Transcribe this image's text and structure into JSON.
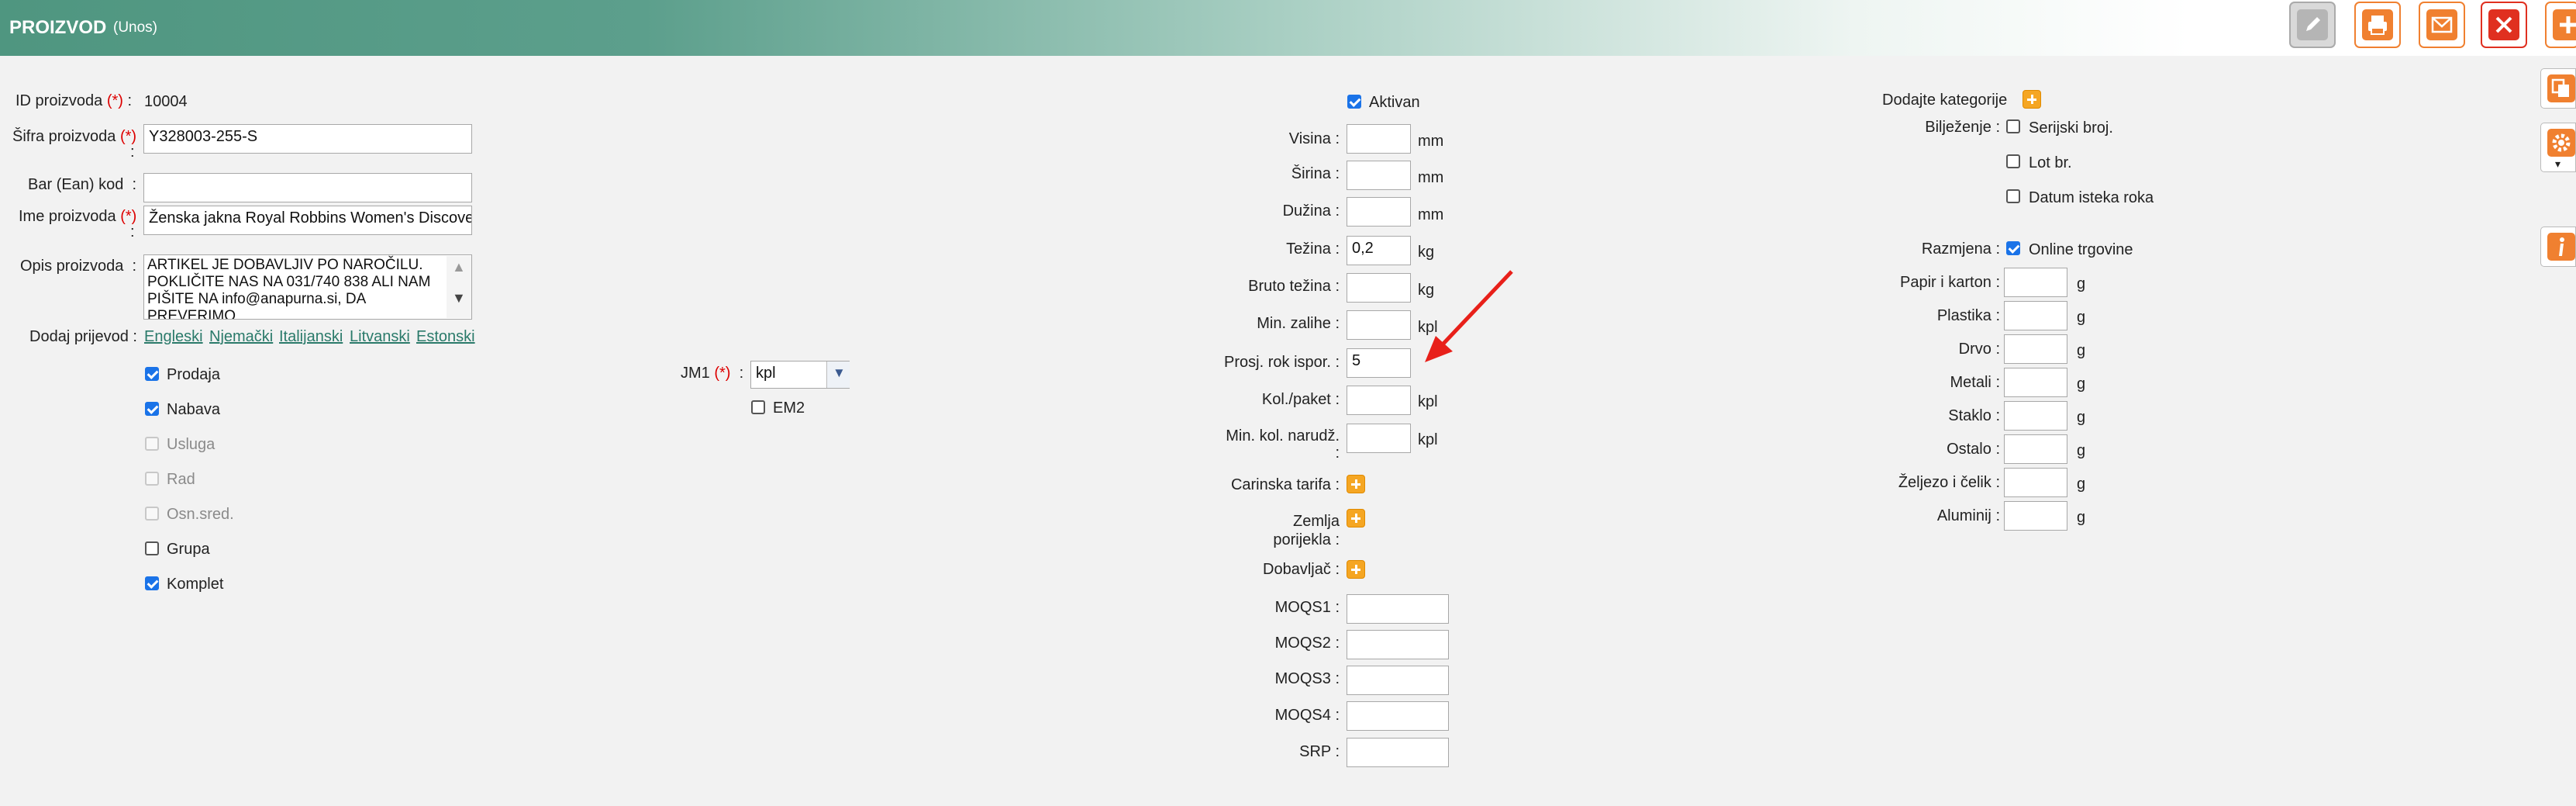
{
  "header": {
    "title": "PROIZVOD",
    "subtitle": "(Unos)",
    "buttons": [
      {
        "name": "edit-icon",
        "color": "#b0b0b0"
      },
      {
        "name": "print-icon",
        "color": "#f08030"
      },
      {
        "name": "email-icon",
        "color": "#f08030"
      },
      {
        "name": "close-icon",
        "color": "#e03020"
      },
      {
        "name": "add-icon",
        "color": "#f08030"
      }
    ]
  },
  "left": {
    "id_label": "ID proizvoda",
    "id_value": "10004",
    "sifra_label": "Šifra proizvoda",
    "sifra_value": "Y328003-255-S",
    "ean_label": "Bar (Ean) kod",
    "ean_value": "",
    "ime_label": "Ime proizvoda",
    "ime_value": "Ženska jakna Royal Robbins Women's Discovery",
    "opis_label": "Opis proizvoda",
    "opis_value": "ARTIKEL JE DOBAVLJIV PO NAROČILU. POKLIČITE NAS NA 031/740 838 ALI NAM PIŠITE NA info@anapurna.si, DA PREVERIMO",
    "prijevod_label": "Dodaj prijevod",
    "languages": [
      "Engleski",
      "Njemački",
      "Italijanski",
      "Litvanski",
      "Estonski"
    ],
    "required_mark": "(*)",
    "colon": ":",
    "checkboxes": [
      {
        "label": "Prodaja",
        "checked": true,
        "disabled": false
      },
      {
        "label": "Nabava",
        "checked": true,
        "disabled": false
      },
      {
        "label": "Usluga",
        "checked": false,
        "disabled": true
      },
      {
        "label": "Rad",
        "checked": false,
        "disabled": true
      },
      {
        "label": "Osn.sred.",
        "checked": false,
        "disabled": true
      },
      {
        "label": "Grupa",
        "checked": false,
        "disabled": false
      },
      {
        "label": "Komplet",
        "checked": true,
        "disabled": false
      }
    ]
  },
  "jm": {
    "label": "JM1",
    "value": "kpl",
    "em2_label": "EM2"
  },
  "middle": {
    "aktivan_label": "Aktivan",
    "fields": [
      {
        "label": "Visina",
        "value": "",
        "unit": "mm"
      },
      {
        "label": "Širina",
        "value": "",
        "unit": "mm"
      },
      {
        "label": "Dužina",
        "value": "",
        "unit": "mm"
      },
      {
        "label": "Težina",
        "value": "0,2",
        "unit": "kg"
      },
      {
        "label": "Bruto težina",
        "value": "",
        "unit": "kg"
      },
      {
        "label": "Min. zalihe",
        "value": "",
        "unit": "kpl"
      },
      {
        "label": "Prosj. rok ispor.",
        "value": "5",
        "unit": ""
      },
      {
        "label": "Kol./paket",
        "value": "",
        "unit": "kpl"
      },
      {
        "label": "Min. kol. narudž.",
        "value": "",
        "unit": "kpl"
      }
    ],
    "carinska_label": "Carinska tarifa",
    "zemlja_label": "Zemlja porijekla",
    "dobavljac_label": "Dobavljač",
    "moqs": [
      {
        "label": "MOQS1",
        "value": ""
      },
      {
        "label": "MOQS2",
        "value": ""
      },
      {
        "label": "MOQS3",
        "value": ""
      },
      {
        "label": "MOQS4",
        "value": ""
      },
      {
        "label": "SRP",
        "value": ""
      }
    ]
  },
  "right": {
    "kategorije_label": "Dodajte kategorije",
    "biljezenje_label": "Bilježenje",
    "biljezenje_options": [
      "Serijski broj.",
      "Lot br.",
      "Datum isteka roka"
    ],
    "razmjena_label": "Razmjena",
    "razmjena_option": "Online trgovine",
    "packaging": [
      {
        "label": "Papir i karton",
        "unit": "g"
      },
      {
        "label": "Plastika",
        "unit": "g"
      },
      {
        "label": "Drvo",
        "unit": "g"
      },
      {
        "label": "Metali",
        "unit": "g"
      },
      {
        "label": "Staklo",
        "unit": "g"
      },
      {
        "label": "Ostalo",
        "unit": "g"
      },
      {
        "label": "Željezo i čelik",
        "unit": "g"
      },
      {
        "label": "Aluminij",
        "unit": "g"
      }
    ]
  },
  "colors": {
    "header_start": "#4f9680",
    "accent_orange": "#f5a623",
    "checkbox_blue": "#1a73e8",
    "required_red": "#d00000",
    "arrow_red": "#e8201a"
  }
}
